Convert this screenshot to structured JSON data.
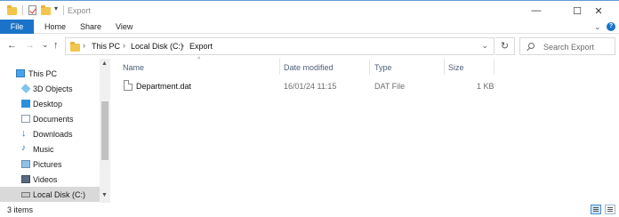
{
  "window": {
    "title": "Export",
    "minimize": "—",
    "maximize": "☐",
    "close": "✕"
  },
  "ribbon": {
    "tabs": [
      "File",
      "Home",
      "Share",
      "View"
    ],
    "expand": "⌄",
    "help": "?"
  },
  "nav": {
    "back": "←",
    "forward": "→",
    "recent": "⌄",
    "up": "↑",
    "breadcrumb": [
      "This PC",
      "Local Disk (C:)",
      "Export"
    ],
    "crumb_separator": "›",
    "address_dropdown": "⌄",
    "refresh": "↻"
  },
  "search": {
    "placeholder": "Search Export"
  },
  "sidebar": {
    "items": [
      {
        "label": "This PC",
        "icon": "computer-icon"
      },
      {
        "label": "3D Objects",
        "icon": "cube-icon"
      },
      {
        "label": "Desktop",
        "icon": "desktop-icon"
      },
      {
        "label": "Documents",
        "icon": "documents-icon"
      },
      {
        "label": "Downloads",
        "icon": "download-arrow-icon"
      },
      {
        "label": "Music",
        "icon": "music-note-icon"
      },
      {
        "label": "Pictures",
        "icon": "pictures-icon"
      },
      {
        "label": "Videos",
        "icon": "video-icon"
      },
      {
        "label": "Local Disk (C:)",
        "icon": "drive-icon",
        "selected": true
      }
    ],
    "scroll_up": "▲",
    "scroll_down": "▼"
  },
  "columns": {
    "name": "Name",
    "date": "Date modified",
    "type": "Type",
    "size": "Size",
    "sort_indicator": "^"
  },
  "files": [
    {
      "name": "Department.dat",
      "date": "16/01/24 11:15",
      "type": "DAT File",
      "size": "1 KB"
    }
  ],
  "status": {
    "item_count": "3 items"
  },
  "colors": {
    "accent": "#1a73c8",
    "folder": "#f2c64c",
    "selection": "#d9d9d9",
    "column_header_text": "#4d5e78"
  }
}
